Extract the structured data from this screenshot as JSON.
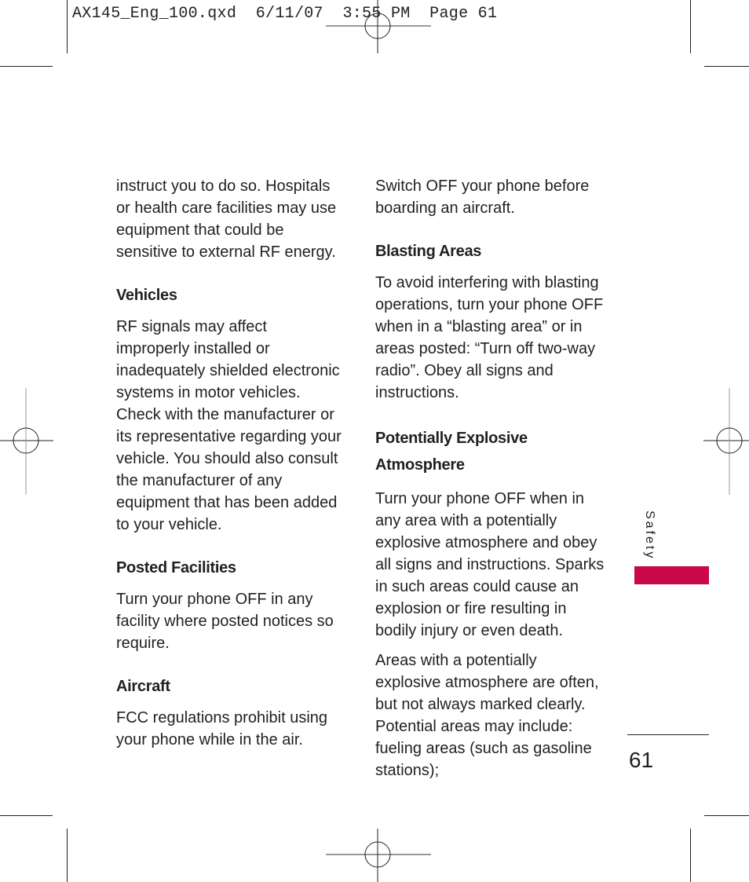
{
  "slug_line": "AX145_Eng_100.qxd  6/11/07  3:55 PM  Page 61",
  "left_column": {
    "intro": "instruct you to do so. Hospitals or health care facilities may use equipment that could be sensitive to external RF energy.",
    "sections": [
      {
        "heading": "Vehicles",
        "body": "RF signals may affect improperly installed or inadequately shielded electronic systems in motor vehicles. Check with the manufacturer or its representative regarding your vehicle.  You should also consult the manufacturer of any equipment that has been added to your vehicle."
      },
      {
        "heading": "Posted Facilities",
        "body": "Turn your phone OFF in any facility where posted notices so require."
      },
      {
        "heading": "Aircraft",
        "body": "FCC regulations prohibit using your phone while in the air."
      }
    ]
  },
  "right_column": {
    "intro": "Switch OFF your phone before boarding an aircraft.",
    "sections": [
      {
        "heading": "Blasting Areas",
        "body": "To avoid interfering with blasting operations, turn your phone OFF when in a “blasting area” or in areas posted: “Turn off two-way radio”. Obey all signs and instructions."
      },
      {
        "heading": "Potentially Explosive Atmosphere",
        "body": "Turn your phone OFF when in any area with a potentially explosive atmosphere and obey all signs and instructions. Sparks in such areas could cause an explosion or fire resulting in bodily injury or even death.",
        "body2": "Areas with a potentially explosive atmosphere are often, but not always marked clearly. Potential areas may include: fueling areas (such as gasoline stations);"
      }
    ]
  },
  "side_tab": {
    "label": "Safety",
    "color": "#c8084a"
  },
  "page_number": "61"
}
